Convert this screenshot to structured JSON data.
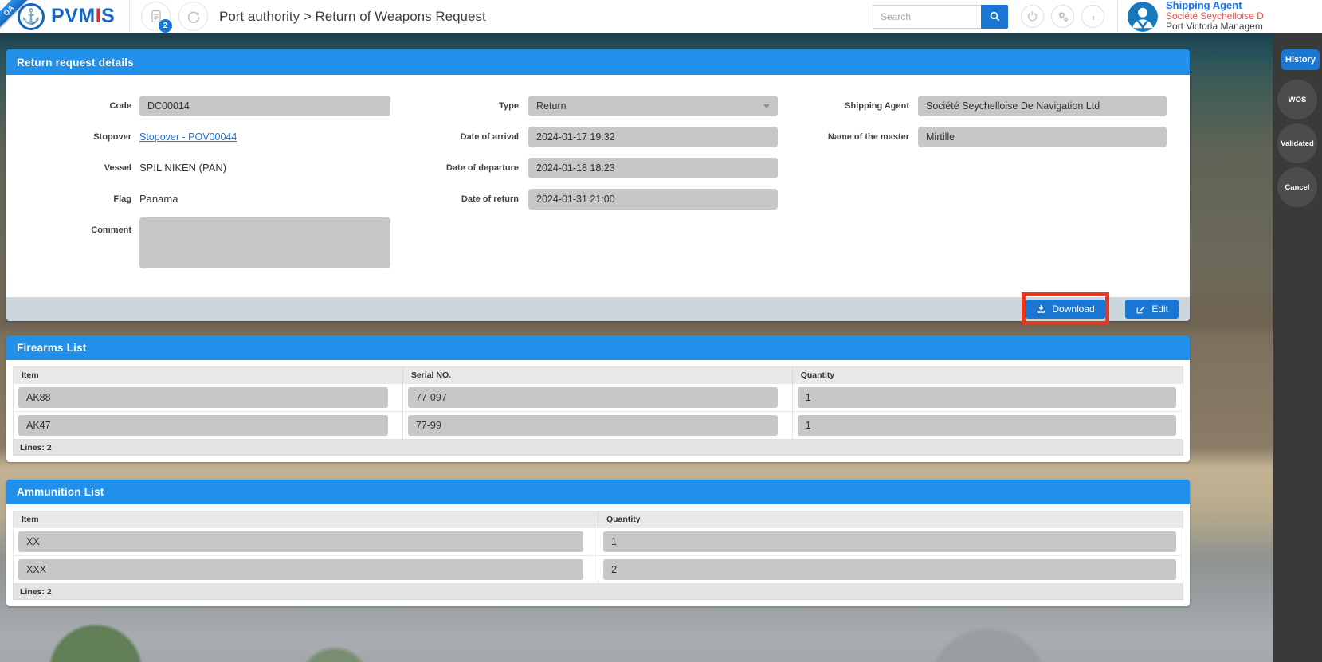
{
  "topbar": {
    "qa_ribbon": "QA",
    "logo": {
      "part1": "PVM",
      "part2": "I",
      "part3": "S",
      "anchor_glyph": "⚓"
    },
    "doc_badge_count": "2",
    "breadcrumb": "Port authority > Return of Weapons Request",
    "search": {
      "placeholder": "Search"
    },
    "user": {
      "role": "Shipping Agent",
      "company": "Société Seychelloise D",
      "org": "Port Victoria Managem"
    }
  },
  "details_panel": {
    "title": "Return request details",
    "fields": {
      "code": {
        "label": "Code",
        "value": "DC00014"
      },
      "stopover": {
        "label": "Stopover",
        "link": "Stopover - POV00044"
      },
      "vessel": {
        "label": "Vessel",
        "value": "SPIL NIKEN (PAN)"
      },
      "flag": {
        "label": "Flag",
        "value": "Panama"
      },
      "comment": {
        "label": "Comment",
        "value": ""
      },
      "type": {
        "label": "Type",
        "value": "Return"
      },
      "date_of_arrival": {
        "label": "Date of arrival",
        "value": "2024-01-17 19:32"
      },
      "date_of_departure": {
        "label": "Date of departure",
        "value": "2024-01-18 18:23"
      },
      "date_of_return": {
        "label": "Date of return",
        "value": "2024-01-31 21:00"
      },
      "shipping_agent": {
        "label": "Shipping Agent",
        "value": "Société Seychelloise De Navigation Ltd"
      },
      "master": {
        "label": "Name of the master",
        "value": "Mirtille"
      }
    },
    "actions": {
      "download": "Download",
      "edit": "Edit"
    }
  },
  "firearms": {
    "title": "Firearms List",
    "columns": [
      "Item",
      "Serial NO.",
      "Quantity"
    ],
    "rows": [
      [
        "AK88",
        "77-097",
        "1"
      ],
      [
        "AK47",
        "77-99",
        "1"
      ]
    ],
    "footer": "Lines: 2"
  },
  "ammunition": {
    "title": "Ammunition List",
    "columns": [
      "Item",
      "Quantity"
    ],
    "rows": [
      [
        "XX",
        "1"
      ],
      [
        "XXX",
        "2"
      ]
    ],
    "footer": "Lines: 2"
  },
  "rail": {
    "history": "History",
    "buttons": [
      "WOS",
      "Validated",
      "Cancel"
    ]
  },
  "colors": {
    "header_blue": "#2090ea",
    "button_blue": "#1976d2",
    "annotation_red": "#e8371f",
    "input_gray": "#c7c7c7"
  }
}
